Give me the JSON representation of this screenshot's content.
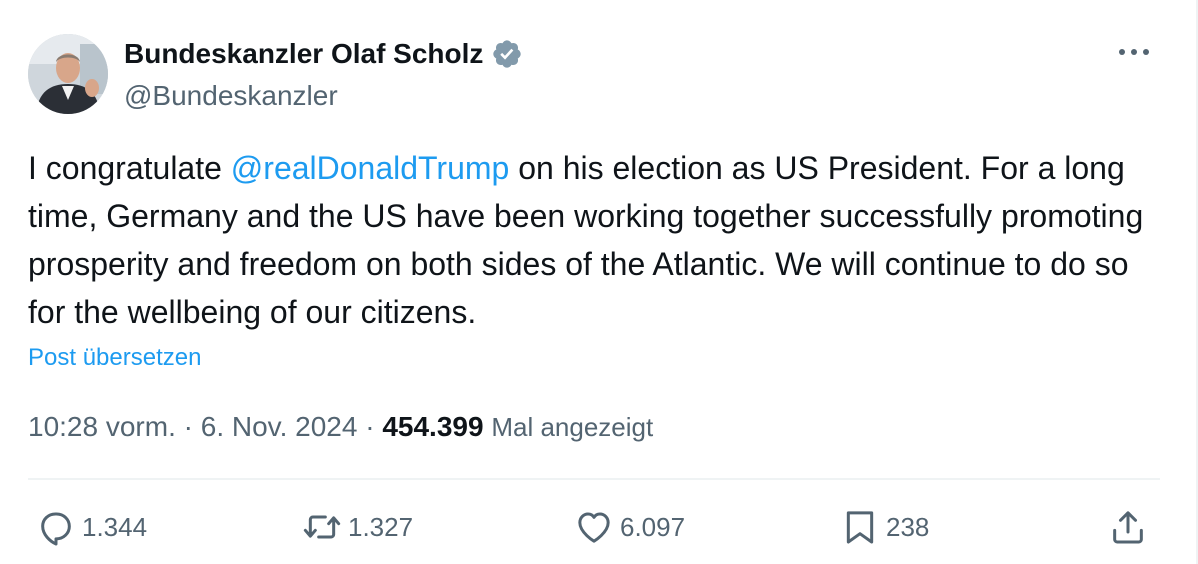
{
  "author": {
    "display_name": "Bundeskanzler Olaf Scholz",
    "handle": "@Bundeskanzler",
    "verified": true,
    "verified_color": "#829aab"
  },
  "tweet": {
    "text_before": "I congratulate ",
    "mention": "@realDonaldTrump",
    "text_after": " on his election as US President. For a long time, Germany and the US have been working together successfully promoting prosperity and freedom on both sides of the Atlantic. We will continue to do so for the wellbeing of our citizens.",
    "translate_label": "Post übersetzen",
    "mention_color": "#1d9bf0"
  },
  "meta": {
    "time": "10:28 vorm.",
    "separator": " · ",
    "date": "6. Nov. 2024",
    "views_count": "454.399",
    "views_label": "Mal angezeigt"
  },
  "actions": {
    "reply_count": "1.344",
    "retweet_count": "1.327",
    "like_count": "6.097",
    "bookmark_count": "238"
  },
  "icons": [
    "more-icon",
    "verified-icon",
    "reply-icon",
    "retweet-icon",
    "like-icon",
    "bookmark-icon",
    "share-icon"
  ]
}
